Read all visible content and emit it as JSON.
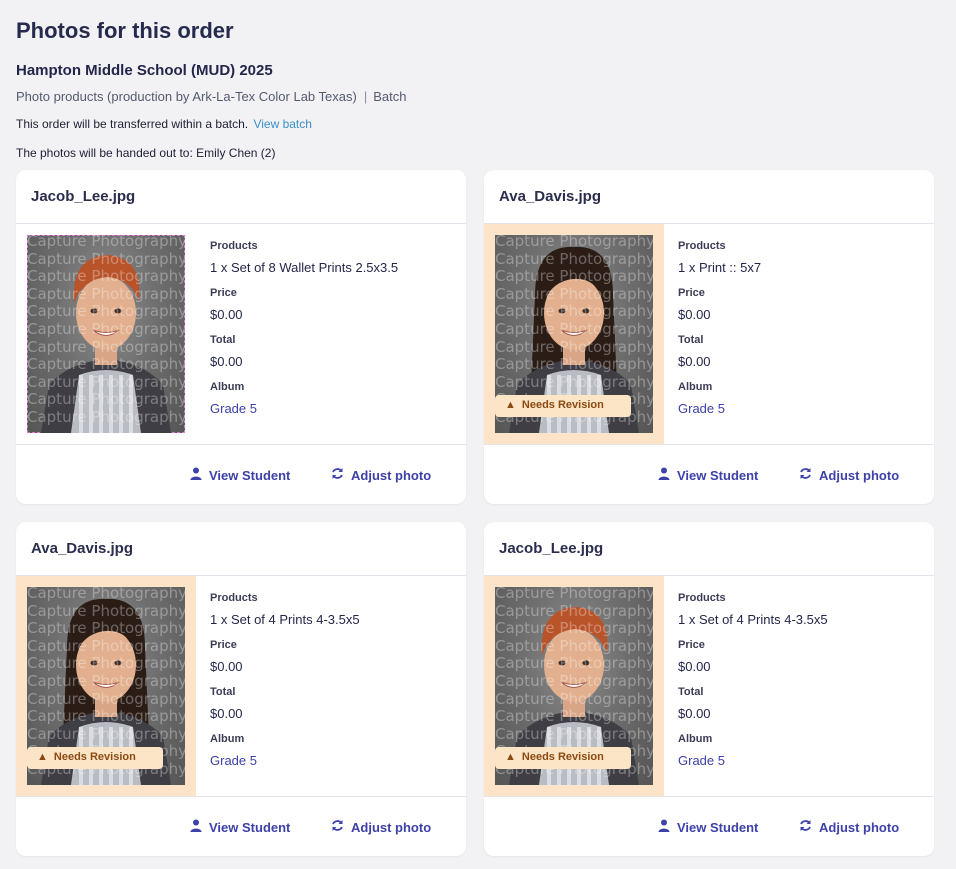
{
  "page": {
    "title": "Photos for this order",
    "order_name": "Hampton Middle School (MUD) 2025",
    "products_line": "Photo products (production by Ark-La-Tex Color Lab Texas)",
    "separator": "|",
    "batch_label": "Batch",
    "transfer_text": "This order will be transferred within a batch.",
    "view_batch_link": "View batch",
    "handout_text": "The photos will be handed out to: Emily Chen (2)"
  },
  "labels": {
    "products": "Products",
    "price": "Price",
    "total": "Total",
    "album": "Album",
    "view_student": "View Student",
    "adjust_photo": "Adjust photo",
    "needs_revision": "Needs Revision",
    "watermark": "Capture Photography"
  },
  "cards": [
    {
      "filename": "Jacob_Lee.jpg",
      "product": "1 x Set of 8 Wallet Prints 2.5x3.5",
      "price": "$0.00",
      "total": "$0.00",
      "album": "Grade 5",
      "needs_revision": false
    },
    {
      "filename": "Ava_Davis.jpg",
      "product": "1 x Print :: 5x7",
      "price": "$0.00",
      "total": "$0.00",
      "album": "Grade 5",
      "needs_revision": true
    },
    {
      "filename": "Ava_Davis.jpg",
      "product": "1 x Set of 4 Prints 4-3.5x5",
      "price": "$0.00",
      "total": "$0.00",
      "album": "Grade 5",
      "needs_revision": true
    },
    {
      "filename": "Jacob_Lee.jpg",
      "product": "1 x Set of 4 Prints 4-3.5x5",
      "price": "$0.00",
      "total": "$0.00",
      "album": "Grade 5",
      "needs_revision": true
    }
  ],
  "colors": {
    "accent": "#3d41a8",
    "revision_bg": "#fde3c8",
    "revision_badge": "#fbe5c6"
  },
  "icons": [
    "user-icon",
    "rotate-icon",
    "warning-icon"
  ]
}
